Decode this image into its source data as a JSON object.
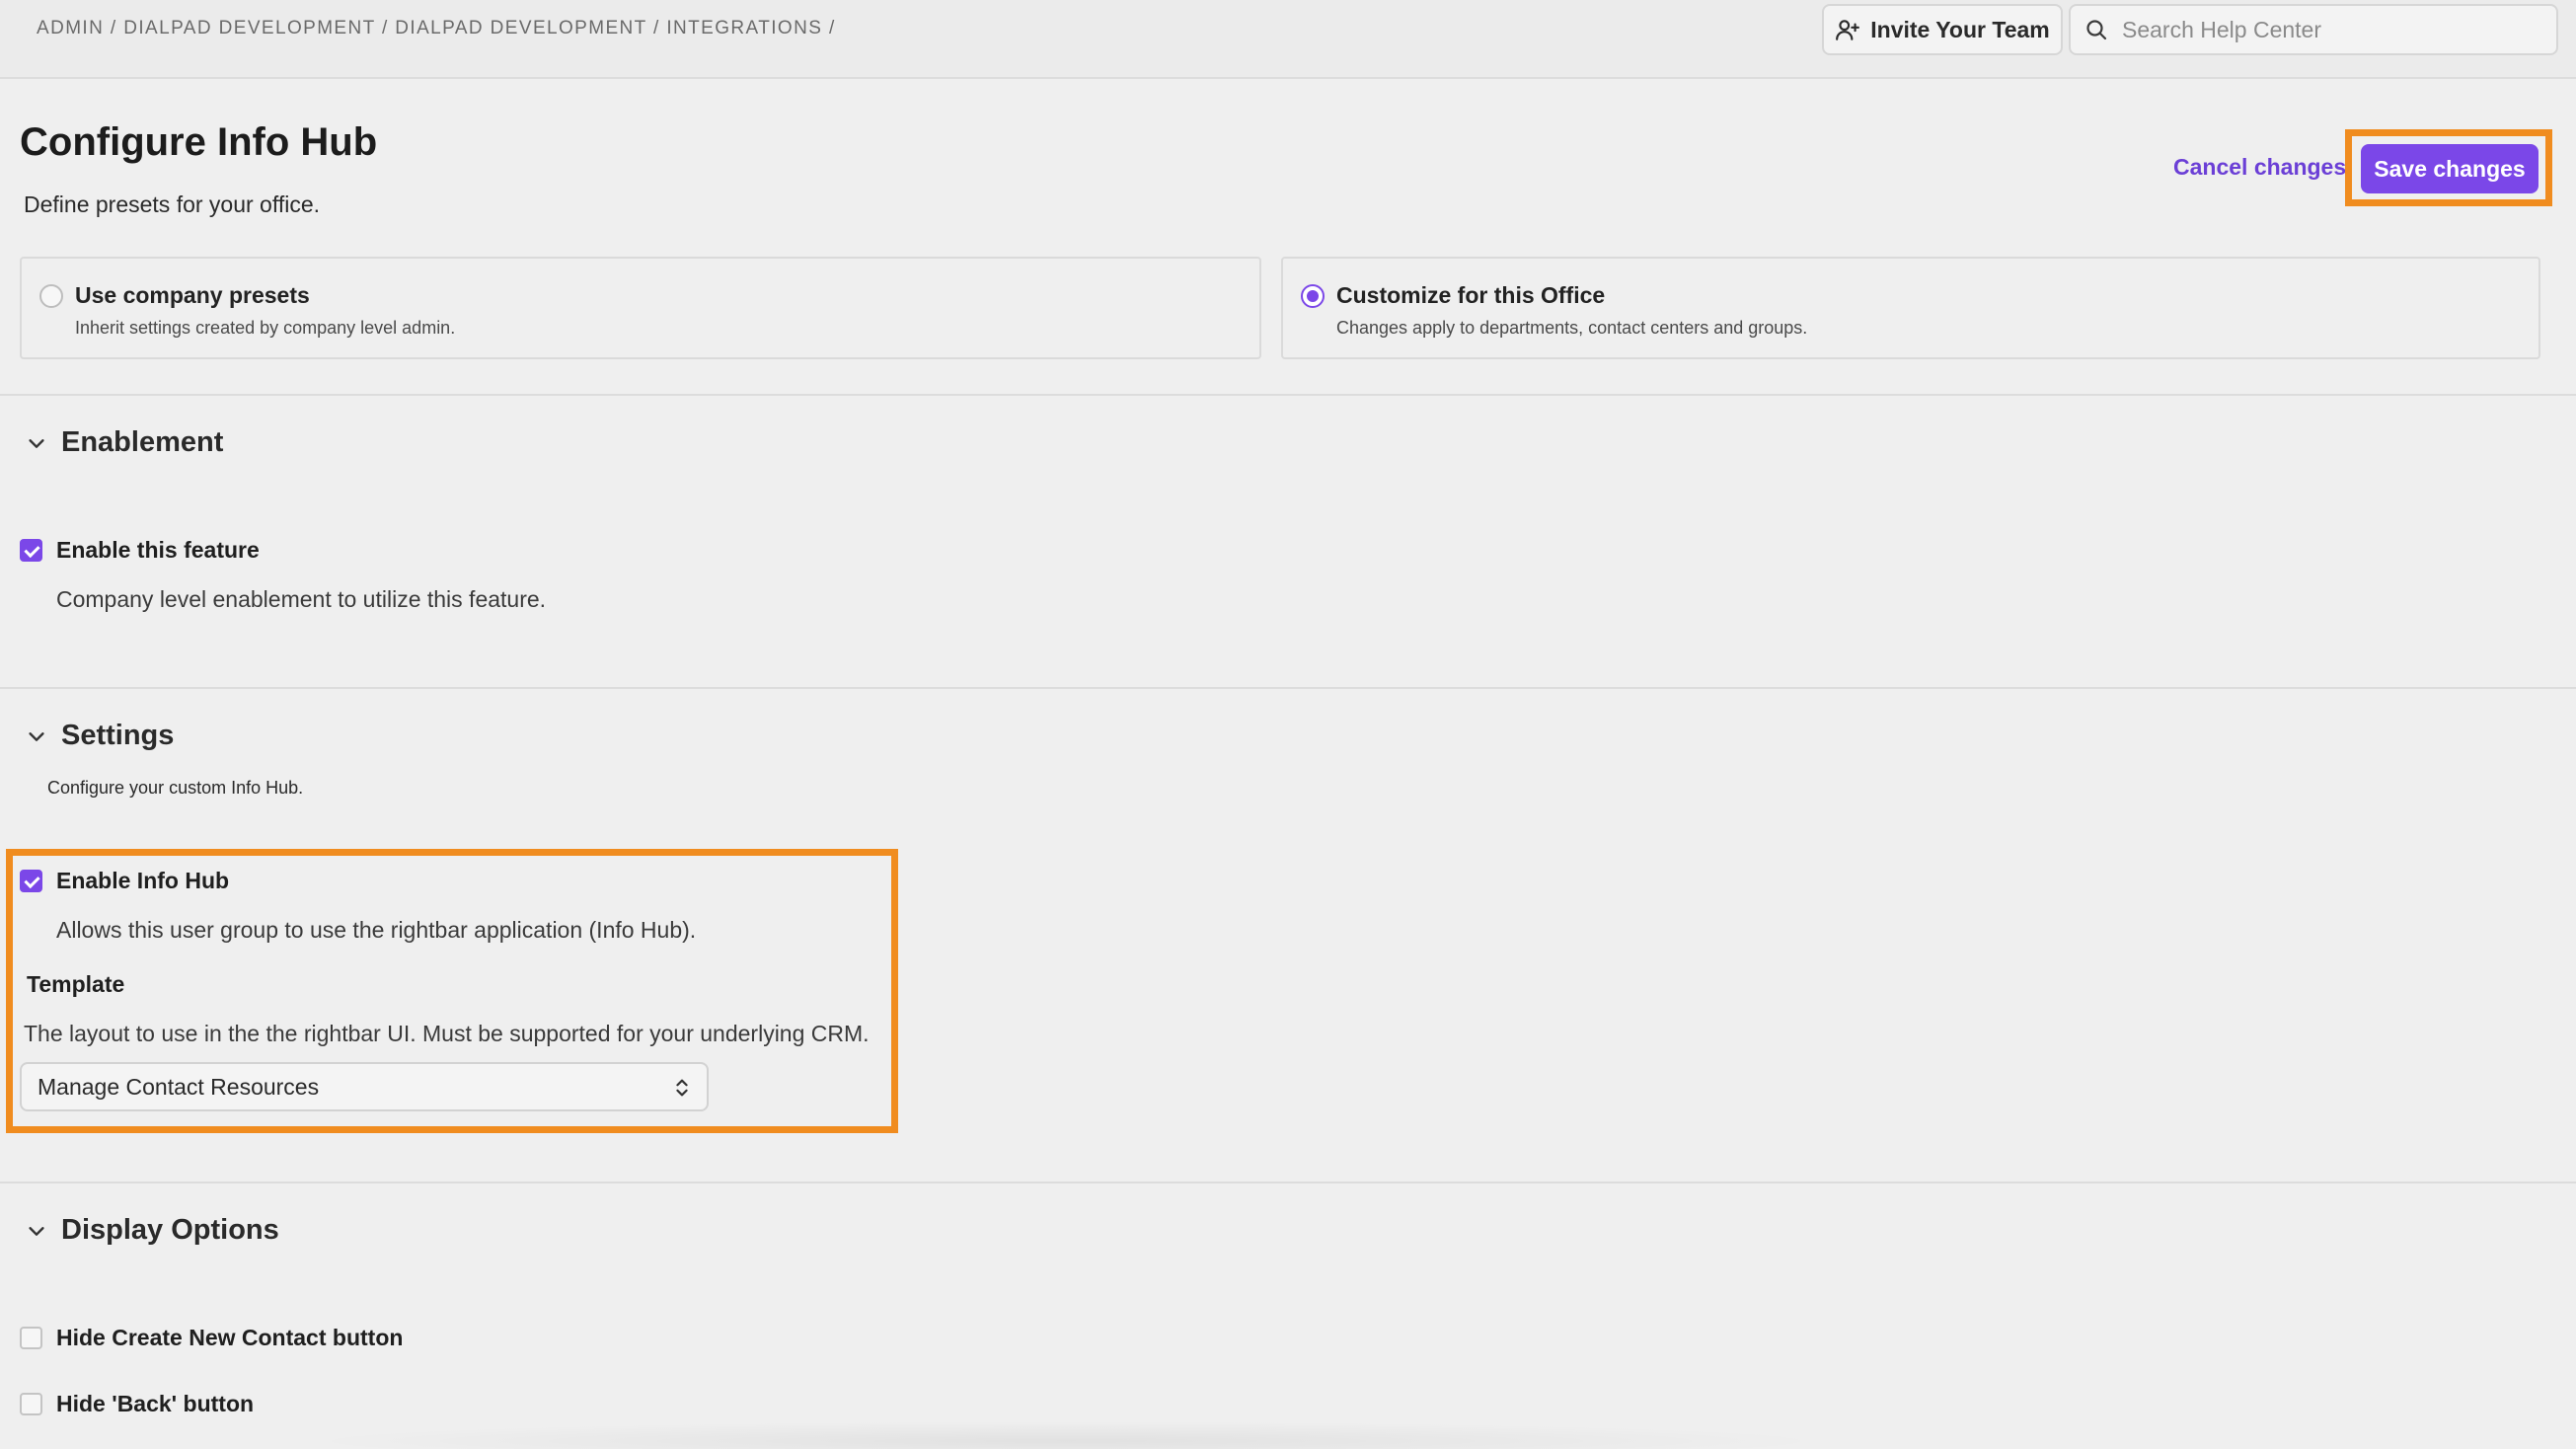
{
  "breadcrumb": "ADMIN / DIALPAD DEVELOPMENT / DIALPAD DEVELOPMENT / INTEGRATIONS /",
  "header": {
    "invite_label": "Invite Your Team",
    "search_placeholder": "Search Help Center"
  },
  "page": {
    "title": "Configure Info Hub",
    "subtitle": "Define presets for your office.",
    "cancel_label": "Cancel changes",
    "save_label": "Save changes"
  },
  "presets": [
    {
      "title": "Use company presets",
      "description": "Inherit settings created by company level admin.",
      "selected": false
    },
    {
      "title": "Customize for this Office",
      "description": "Changes apply to departments, contact centers and groups.",
      "selected": true
    }
  ],
  "enablement": {
    "title": "Enablement",
    "feature_label": "Enable this feature",
    "feature_checked": true,
    "feature_help": "Company level enablement to utilize this feature."
  },
  "settings": {
    "title": "Settings",
    "description": "Configure your custom Info Hub.",
    "infohub_label": "Enable Info Hub",
    "infohub_checked": true,
    "infohub_help": "Allows this user group to use the rightbar application (Info Hub).",
    "template_label": "Template",
    "template_help": "The layout to use in the the rightbar UI. Must be supported for your underlying CRM.",
    "template_value": "Manage Contact Resources"
  },
  "display_options": {
    "title": "Display Options",
    "options": [
      {
        "label": "Hide Create New Contact button",
        "checked": false
      },
      {
        "label": "Hide 'Back' button",
        "checked": false
      }
    ]
  },
  "colors": {
    "accent": "#7b47e8",
    "highlight": "#f08c1f"
  }
}
